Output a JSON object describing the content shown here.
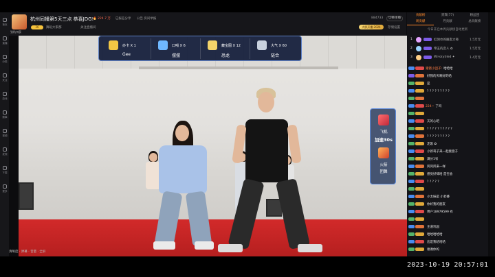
{
  "header": {
    "streamer_name": "张杭州辰",
    "room_title": "杭州同播第5天三点 恭喜JDG!",
    "hot_count": "224.7 万",
    "follow_label": "已报名分享",
    "report_label": "公告 房间举报",
    "level_badge": "26",
    "subtitle": "舞蹈大家都",
    "subscribe_label": "关注直播间",
    "right_label": "884733",
    "switch_button": "切换主播",
    "gold_label": "大胖开播·2024",
    "save_label": "存储设置"
  },
  "left_nav": [
    {
      "label": "首页",
      "icon": "home-icon"
    },
    {
      "label": "直播",
      "icon": "live-icon"
    },
    {
      "label": "分类",
      "icon": "category-icon"
    },
    {
      "label": "关注",
      "icon": "follow-icon"
    },
    {
      "label": "游戏",
      "icon": "game-icon"
    },
    {
      "label": "赛事",
      "icon": "trophy-icon"
    },
    {
      "label": "视频",
      "icon": "video-icon"
    },
    {
      "label": "发现",
      "icon": "discover-icon"
    },
    {
      "label": "下载",
      "icon": "download-icon"
    },
    {
      "label": "更多",
      "icon": "more-icon"
    }
  ],
  "gifts": [
    {
      "qty": "办卡 X 1",
      "name": "Gee",
      "color": "#f2c744"
    },
    {
      "qty": "口哨 X 6",
      "name": "摆摆",
      "color": "#6fb8ff"
    },
    {
      "qty": "藏宝图 X 12",
      "name": "恐龙",
      "color": "#f3d36a"
    },
    {
      "qty": "大气 X 60",
      "name": "链合",
      "color": "#c8d1de"
    }
  ],
  "side_widget": {
    "top_label": "飞机",
    "timer": "加速30s",
    "bottom_label1": "火箭",
    "bottom_label2": "团舞"
  },
  "video_controls": "清晰度 · 弹幕 · 音量 · 全屏",
  "right_panel": {
    "tabs": [
      "贡献榜",
      "贵宾(77)",
      "粉丝团"
    ],
    "subtabs": [
      "周贡献",
      "月贡献",
      "总贡献榜"
    ],
    "rank_hint": "今日开启本周贡献榜自动更新",
    "ranking": [
      {
        "no": "1",
        "name": "红领巾的朋友大哥",
        "score": "1.5万元",
        "color": "#e3a3ff"
      },
      {
        "no": "2",
        "name": "帝王的恋人 ✿",
        "score": "1.5万元",
        "color": "#9bd4ff"
      },
      {
        "no": "3",
        "name": "Wi·lo(yi)led ✦",
        "score": "1.4万元",
        "color": "#ffcf86"
      }
    ],
    "chat": [
      {
        "name": "猪猪小团子:",
        "text": "哈哈哈",
        "lv": "#4a8cf0",
        "fan": "#e04a4a"
      },
      {
        "name": "",
        "text": "好我的天啊好的哈",
        "lv": "#7d5ce8",
        "fan": "#e0733a"
      },
      {
        "name": "",
        "text": "是",
        "lv": "#56b46a",
        "fan": "#e0a93a"
      },
      {
        "name": "",
        "text": "? ? ? ? ? ? ? ? ?",
        "lv": "#4a8cf0",
        "fan": "#e0a93a"
      },
      {
        "name": "",
        "text": "",
        "lv": "#56b46a",
        "fan": "#e0733a"
      },
      {
        "name": "224~",
        "text": "了吗",
        "lv": "#4a8cf0",
        "fan": "#e04a4a"
      },
      {
        "name": "",
        "text": "",
        "lv": "#56b46a",
        "fan": "#e0a93a"
      },
      {
        "name": "",
        "text": "天的心吧",
        "lv": "#4a8cf0",
        "fan": "#e04a4a"
      },
      {
        "name": "",
        "text": "? ? ? ? ? ? ? ? ? ?",
        "lv": "#56b46a",
        "fan": "#e0a93a"
      },
      {
        "name": "",
        "text": "? ? ? ? ? ? ? ? ?",
        "lv": "#4a8cf0",
        "fan": "#e0733a"
      },
      {
        "name": "",
        "text": "走歌 ✿",
        "lv": "#56b46a",
        "fan": "#e0a93a"
      },
      {
        "name": "",
        "text": "小新哥子来一起接盘子",
        "lv": "#4a8cf0",
        "fan": "#e04a4a"
      },
      {
        "name": "",
        "text": "满分1号",
        "lv": "#56b46a",
        "fan": "#e0a93a"
      },
      {
        "name": "",
        "text": "风风风来一样",
        "lv": "#4a8cf0",
        "fan": "#e0733a"
      },
      {
        "name": "",
        "text": "感觉好嗨哈 是否会",
        "lv": "#56b46a",
        "fan": "#e0a93a"
      },
      {
        "name": "",
        "text": "? ? ? ? ?",
        "lv": "#4a8cf0",
        "fan": "#e04a4a"
      },
      {
        "name": "",
        "text": "",
        "lv": "#56b46a",
        "fan": "#e0a93a"
      },
      {
        "name": "",
        "text": "小太妹是  小老婆",
        "lv": "#4a8cf0",
        "fan": "#e0733a"
      },
      {
        "name": "",
        "text": "你好我的朋友",
        "lv": "#56b46a",
        "fan": "#e0a93a"
      },
      {
        "name": "",
        "text": "用户18979599 有",
        "lv": "#4a8cf0",
        "fan": "#e04a4a"
      },
      {
        "name": "",
        "text": "",
        "lv": "#56b46a",
        "fan": "#e0a93a"
      },
      {
        "name": "",
        "text": "王道巩固",
        "lv": "#4a8cf0",
        "fan": "#e0733a"
      },
      {
        "name": "",
        "text": "哈哈哈哈哈",
        "lv": "#56b46a",
        "fan": "#e0a93a"
      },
      {
        "name": "",
        "text": "这是我哈哈哈",
        "lv": "#4a8cf0",
        "fan": "#e04a4a"
      },
      {
        "name": "",
        "text": "谢谢你的",
        "lv": "#56b46a",
        "fan": "#e0a93a"
      }
    ]
  },
  "timestamp": "2023-10-19  20:57:01"
}
